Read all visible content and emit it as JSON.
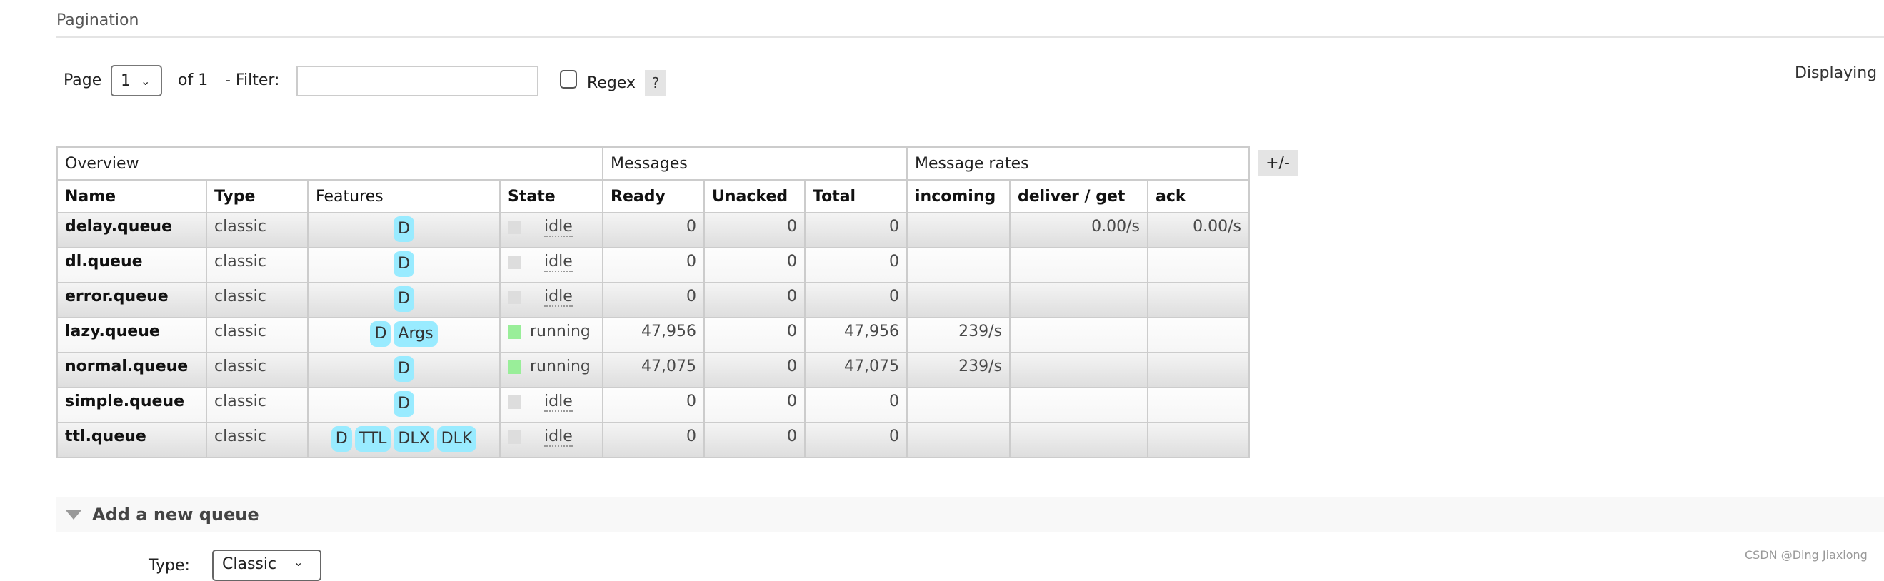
{
  "pagination": {
    "title": "Pagination",
    "page_label": "Page",
    "page_value": "1",
    "of_label": "of 1",
    "filter_label": "- Filter:",
    "filter_value": "",
    "regex_label": "Regex",
    "regex_checked": false,
    "help_label": "?",
    "displaying": "Displaying"
  },
  "table": {
    "groups": [
      "Overview",
      "Messages",
      "Message rates"
    ],
    "columns": [
      "Name",
      "Type",
      "Features",
      "State",
      "Ready",
      "Unacked",
      "Total",
      "incoming",
      "deliver / get",
      "ack"
    ],
    "toggle_label": "+/-",
    "state_colors": {
      "idle": "#dddddd",
      "running": "#99ee99"
    },
    "badge_color": "#99ebff",
    "rows": [
      {
        "name": "delay.queue",
        "type": "classic",
        "features": [
          "D"
        ],
        "state": "idle",
        "ready": "0",
        "unacked": "0",
        "total": "0",
        "incoming": "",
        "deliver_get": "0.00/s",
        "ack": "0.00/s"
      },
      {
        "name": "dl.queue",
        "type": "classic",
        "features": [
          "D"
        ],
        "state": "idle",
        "ready": "0",
        "unacked": "0",
        "total": "0",
        "incoming": "",
        "deliver_get": "",
        "ack": ""
      },
      {
        "name": "error.queue",
        "type": "classic",
        "features": [
          "D"
        ],
        "state": "idle",
        "ready": "0",
        "unacked": "0",
        "total": "0",
        "incoming": "",
        "deliver_get": "",
        "ack": ""
      },
      {
        "name": "lazy.queue",
        "type": "classic",
        "features": [
          "D",
          "Args"
        ],
        "state": "running",
        "ready": "47,956",
        "unacked": "0",
        "total": "47,956",
        "incoming": "239/s",
        "deliver_get": "",
        "ack": ""
      },
      {
        "name": "normal.queue",
        "type": "classic",
        "features": [
          "D"
        ],
        "state": "running",
        "ready": "47,075",
        "unacked": "0",
        "total": "47,075",
        "incoming": "239/s",
        "deliver_get": "",
        "ack": ""
      },
      {
        "name": "simple.queue",
        "type": "classic",
        "features": [
          "D"
        ],
        "state": "idle",
        "ready": "0",
        "unacked": "0",
        "total": "0",
        "incoming": "",
        "deliver_get": "",
        "ack": ""
      },
      {
        "name": "ttl.queue",
        "type": "classic",
        "features": [
          "D",
          "TTL",
          "DLX",
          "DLK"
        ],
        "state": "idle",
        "ready": "0",
        "unacked": "0",
        "total": "0",
        "incoming": "",
        "deliver_get": "",
        "ack": ""
      }
    ]
  },
  "add_queue": {
    "title": "Add a new queue",
    "type_label": "Type:",
    "type_value": "Classic"
  },
  "watermark": "CSDN @Ding Jiaxiong"
}
